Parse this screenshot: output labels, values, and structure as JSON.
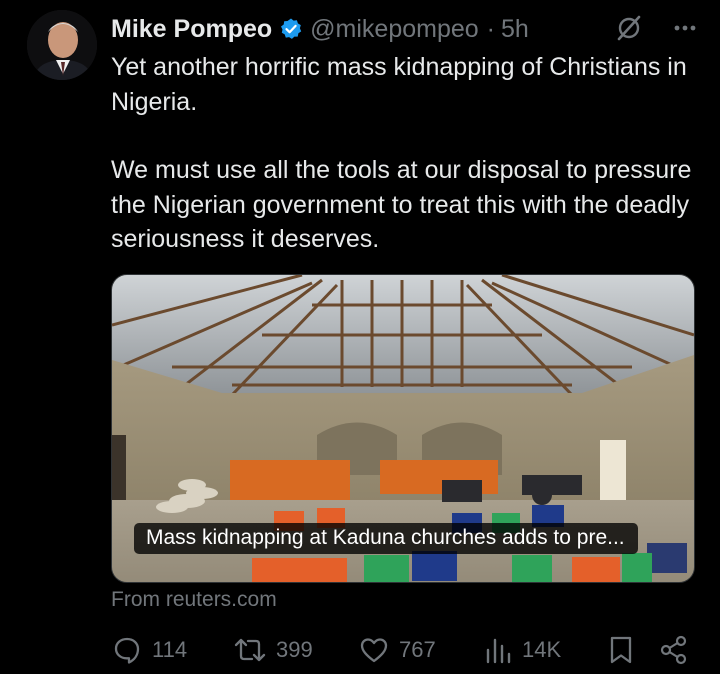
{
  "tweet": {
    "author": {
      "name": "Mike Pompeo",
      "handle": "@mikepompeo",
      "verified": true,
      "verified_color": "#1d9bf0"
    },
    "separator": "·",
    "time": "5h",
    "paragraphs": [
      "Yet another horrific mass kidnapping of Christians in Nigeria.",
      "We must use all the tools at our disposal to pressure the Nigerian government to treat this with the deadly seriousness it deserves."
    ],
    "card": {
      "caption": "Mass kidnapping at Kaduna churches adds to pre...",
      "source": "From reuters.com"
    },
    "actions": {
      "replies": "114",
      "retweets": "399",
      "likes": "767",
      "views": "14K"
    }
  },
  "icons": {
    "reply": "speech-bubble-icon",
    "retweet": "retweet-arrows-icon",
    "like": "heart-icon",
    "views": "bar-chart-icon",
    "bookmark": "bookmark-icon",
    "share": "share-icon",
    "grok": "grok-icon",
    "more": "more-dots-icon"
  },
  "colors": {
    "background": "#000000",
    "text": "#e7e9ea",
    "muted": "#71767b",
    "accent": "#1d9bf0"
  }
}
